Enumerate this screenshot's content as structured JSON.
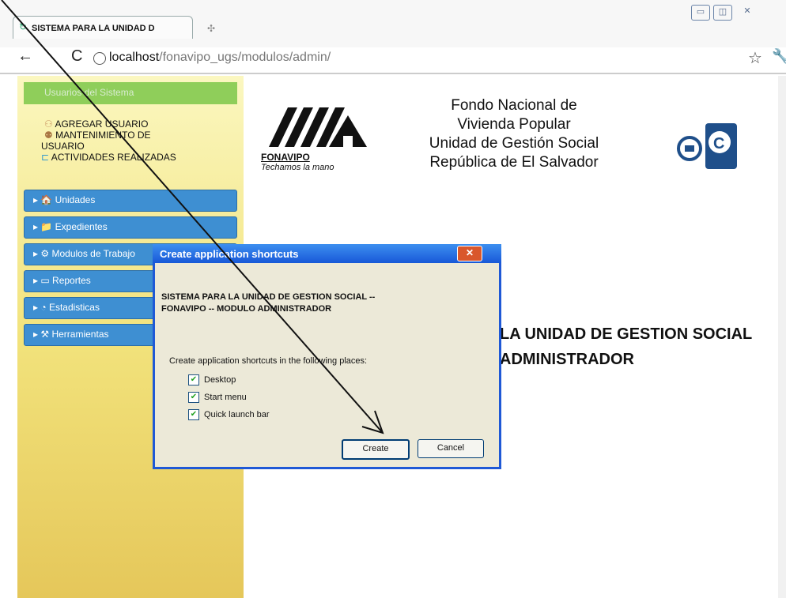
{
  "window": {
    "tab_title": "SISTEMA PARA LA UNIDAD D",
    "controls": [
      "minimize",
      "maximize",
      "close"
    ]
  },
  "addressbar": {
    "url_host": "localhost",
    "url_path": "/fonavipo_ugs/modulos/admin/"
  },
  "sidebar": {
    "header": "Usuarios del Sistema",
    "items": [
      "AGREGAR USUARIO",
      "MANTENIMIENTO DE",
      "USUARIO",
      "ACTIVIDADES REALIZADAS"
    ],
    "menus": [
      "Unidades",
      "Expedientes",
      "Modulos de Trabajo",
      "Reportes",
      "Estadisticas",
      "Herramientas"
    ]
  },
  "header": {
    "logo_name": "FONAVIPO",
    "logo_tagline": "Techamos la mano",
    "org_lines": [
      "Fondo Nacional de",
      "Vivienda Popular",
      "Unidad de Gestión Social",
      "República de El Salvador"
    ]
  },
  "main": {
    "title_line1": "LA UNIDAD DE GESTION SOCIAL",
    "title_line2": "ADMINISTRADOR"
  },
  "dialog": {
    "title": "Create application shortcuts",
    "app_name_line1": "SISTEMA PARA LA UNIDAD DE GESTION SOCIAL --",
    "app_name_line2": "FONAVIPO -- MODULO ADMINISTRADOR",
    "instruction": "Create application shortcuts in the following places:",
    "options": [
      {
        "label": "Desktop",
        "checked": true
      },
      {
        "label": "Start menu",
        "checked": true
      },
      {
        "label": "Quick launch bar",
        "checked": true
      }
    ],
    "create_label": "Create",
    "cancel_label": "Cancel"
  },
  "colors": {
    "accent_blue": "#3e8fd2",
    "sidebar_green": "#8fce5a",
    "dialog_title_blue": "#1858d8"
  }
}
